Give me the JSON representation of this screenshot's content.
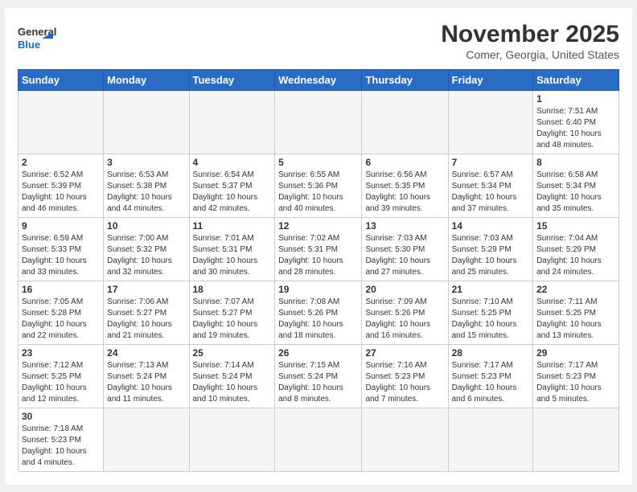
{
  "header": {
    "logo_general": "General",
    "logo_blue": "Blue",
    "month": "November 2025",
    "location": "Comer, Georgia, United States"
  },
  "days_of_week": [
    "Sunday",
    "Monday",
    "Tuesday",
    "Wednesday",
    "Thursday",
    "Friday",
    "Saturday"
  ],
  "weeks": [
    [
      {
        "num": "",
        "info": ""
      },
      {
        "num": "",
        "info": ""
      },
      {
        "num": "",
        "info": ""
      },
      {
        "num": "",
        "info": ""
      },
      {
        "num": "",
        "info": ""
      },
      {
        "num": "",
        "info": ""
      },
      {
        "num": "1",
        "info": "Sunrise: 7:51 AM\nSunset: 6:40 PM\nDaylight: 10 hours\nand 48 minutes."
      }
    ],
    [
      {
        "num": "2",
        "info": "Sunrise: 6:52 AM\nSunset: 5:39 PM\nDaylight: 10 hours\nand 46 minutes."
      },
      {
        "num": "3",
        "info": "Sunrise: 6:53 AM\nSunset: 5:38 PM\nDaylight: 10 hours\nand 44 minutes."
      },
      {
        "num": "4",
        "info": "Sunrise: 6:54 AM\nSunset: 5:37 PM\nDaylight: 10 hours\nand 42 minutes."
      },
      {
        "num": "5",
        "info": "Sunrise: 6:55 AM\nSunset: 5:36 PM\nDaylight: 10 hours\nand 40 minutes."
      },
      {
        "num": "6",
        "info": "Sunrise: 6:56 AM\nSunset: 5:35 PM\nDaylight: 10 hours\nand 39 minutes."
      },
      {
        "num": "7",
        "info": "Sunrise: 6:57 AM\nSunset: 5:34 PM\nDaylight: 10 hours\nand 37 minutes."
      },
      {
        "num": "8",
        "info": "Sunrise: 6:58 AM\nSunset: 5:34 PM\nDaylight: 10 hours\nand 35 minutes."
      }
    ],
    [
      {
        "num": "9",
        "info": "Sunrise: 6:59 AM\nSunset: 5:33 PM\nDaylight: 10 hours\nand 33 minutes."
      },
      {
        "num": "10",
        "info": "Sunrise: 7:00 AM\nSunset: 5:32 PM\nDaylight: 10 hours\nand 32 minutes."
      },
      {
        "num": "11",
        "info": "Sunrise: 7:01 AM\nSunset: 5:31 PM\nDaylight: 10 hours\nand 30 minutes."
      },
      {
        "num": "12",
        "info": "Sunrise: 7:02 AM\nSunset: 5:31 PM\nDaylight: 10 hours\nand 28 minutes."
      },
      {
        "num": "13",
        "info": "Sunrise: 7:03 AM\nSunset: 5:30 PM\nDaylight: 10 hours\nand 27 minutes."
      },
      {
        "num": "14",
        "info": "Sunrise: 7:03 AM\nSunset: 5:29 PM\nDaylight: 10 hours\nand 25 minutes."
      },
      {
        "num": "15",
        "info": "Sunrise: 7:04 AM\nSunset: 5:29 PM\nDaylight: 10 hours\nand 24 minutes."
      }
    ],
    [
      {
        "num": "16",
        "info": "Sunrise: 7:05 AM\nSunset: 5:28 PM\nDaylight: 10 hours\nand 22 minutes."
      },
      {
        "num": "17",
        "info": "Sunrise: 7:06 AM\nSunset: 5:27 PM\nDaylight: 10 hours\nand 21 minutes."
      },
      {
        "num": "18",
        "info": "Sunrise: 7:07 AM\nSunset: 5:27 PM\nDaylight: 10 hours\nand 19 minutes."
      },
      {
        "num": "19",
        "info": "Sunrise: 7:08 AM\nSunset: 5:26 PM\nDaylight: 10 hours\nand 18 minutes."
      },
      {
        "num": "20",
        "info": "Sunrise: 7:09 AM\nSunset: 5:26 PM\nDaylight: 10 hours\nand 16 minutes."
      },
      {
        "num": "21",
        "info": "Sunrise: 7:10 AM\nSunset: 5:25 PM\nDaylight: 10 hours\nand 15 minutes."
      },
      {
        "num": "22",
        "info": "Sunrise: 7:11 AM\nSunset: 5:25 PM\nDaylight: 10 hours\nand 13 minutes."
      }
    ],
    [
      {
        "num": "23",
        "info": "Sunrise: 7:12 AM\nSunset: 5:25 PM\nDaylight: 10 hours\nand 12 minutes."
      },
      {
        "num": "24",
        "info": "Sunrise: 7:13 AM\nSunset: 5:24 PM\nDaylight: 10 hours\nand 11 minutes."
      },
      {
        "num": "25",
        "info": "Sunrise: 7:14 AM\nSunset: 5:24 PM\nDaylight: 10 hours\nand 10 minutes."
      },
      {
        "num": "26",
        "info": "Sunrise: 7:15 AM\nSunset: 5:24 PM\nDaylight: 10 hours\nand 8 minutes."
      },
      {
        "num": "27",
        "info": "Sunrise: 7:16 AM\nSunset: 5:23 PM\nDaylight: 10 hours\nand 7 minutes."
      },
      {
        "num": "28",
        "info": "Sunrise: 7:17 AM\nSunset: 5:23 PM\nDaylight: 10 hours\nand 6 minutes."
      },
      {
        "num": "29",
        "info": "Sunrise: 7:17 AM\nSunset: 5:23 PM\nDaylight: 10 hours\nand 5 minutes."
      }
    ],
    [
      {
        "num": "30",
        "info": "Sunrise: 7:18 AM\nSunset: 5:23 PM\nDaylight: 10 hours\nand 4 minutes."
      },
      {
        "num": "",
        "info": ""
      },
      {
        "num": "",
        "info": ""
      },
      {
        "num": "",
        "info": ""
      },
      {
        "num": "",
        "info": ""
      },
      {
        "num": "",
        "info": ""
      },
      {
        "num": "",
        "info": ""
      }
    ]
  ]
}
